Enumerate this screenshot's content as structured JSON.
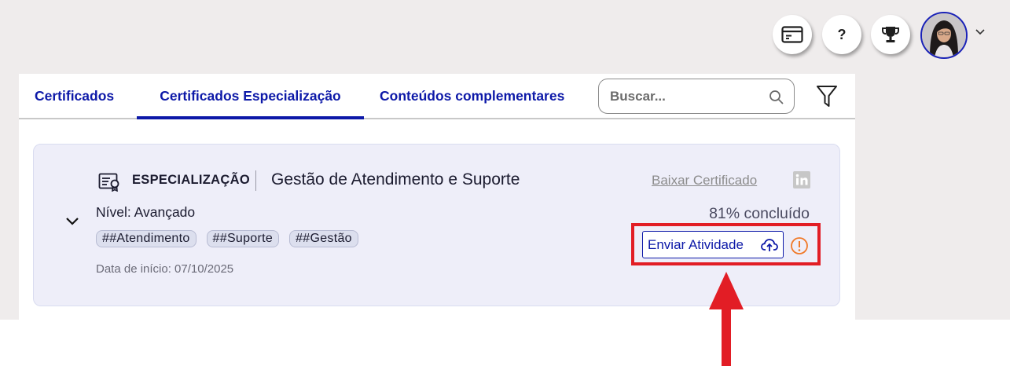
{
  "header": {
    "help_label": "?",
    "buttons": [
      "card-icon",
      "help-icon",
      "trophy-icon",
      "avatar",
      "chevron-down-icon"
    ]
  },
  "tabs": [
    {
      "label": "Certificados",
      "active": false
    },
    {
      "label": "Certificados Especialização",
      "active": true
    },
    {
      "label": "Conteúdos complementares",
      "active": false
    }
  ],
  "search": {
    "placeholder": "Buscar...",
    "value": ""
  },
  "card": {
    "kind": "ESPECIALIZAÇÃO",
    "title": "Gestão de Atendimento e Suporte",
    "level": "Nível: Avançado",
    "tags": [
      "##Atendimento",
      "##Suporte",
      "##Gestão"
    ],
    "start_date": "Data de início: 07/10/2025",
    "download_label": "Baixar Certificado",
    "progress_text": "81% concluído",
    "progress": 0.81,
    "send_label": "Enviar Atividade"
  },
  "colors": {
    "brand": "#0d19a8",
    "card_bg": "#eeeef9",
    "page_bg": "#efecec",
    "annotation": "#e21d25",
    "warning": "#f07a2a"
  }
}
